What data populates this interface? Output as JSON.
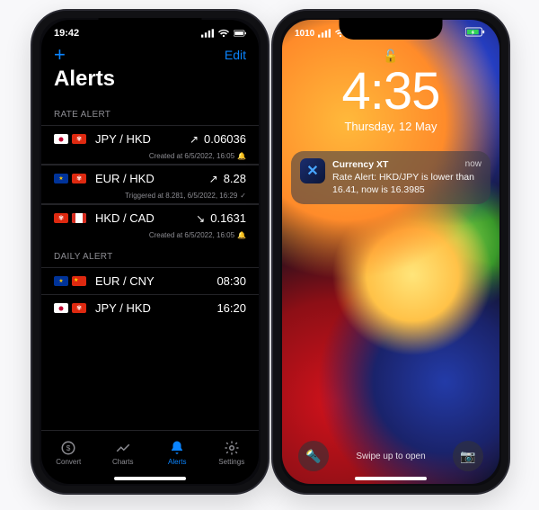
{
  "left": {
    "status": {
      "time": "19:42",
      "icons": [
        "signal",
        "wifi",
        "battery"
      ]
    },
    "nav": {
      "add": "+",
      "edit": "Edit"
    },
    "title": "Alerts",
    "sections": {
      "rate": {
        "label": "RATE ALERT",
        "rows": [
          {
            "flags": [
              "jp",
              "hk"
            ],
            "pair": "JPY / HKD",
            "dir": "↗",
            "rate": "0.06036",
            "meta": "Created at 6/5/2022, 16:05",
            "bell": "🔔"
          },
          {
            "flags": [
              "eu",
              "hk"
            ],
            "pair": "EUR / HKD",
            "dir": "↗",
            "rate": "8.28",
            "meta": "Triggered at 8.281, 6/5/2022, 16:29",
            "bell": "✓"
          },
          {
            "flags": [
              "hk",
              "ca"
            ],
            "pair": "HKD / CAD",
            "dir": "↘",
            "rate": "0.1631",
            "meta": "Created at 6/5/2022, 16:05",
            "bell": "🔔"
          }
        ]
      },
      "daily": {
        "label": "DAILY ALERT",
        "rows": [
          {
            "flags": [
              "eu",
              "cn"
            ],
            "pair": "EUR / CNY",
            "time": "08:30"
          },
          {
            "flags": [
              "jp",
              "hk"
            ],
            "pair": "JPY / HKD",
            "time": "16:20"
          }
        ]
      }
    },
    "tabs": [
      {
        "name": "Convert",
        "active": false
      },
      {
        "name": "Charts",
        "active": false
      },
      {
        "name": "Alerts",
        "active": true
      },
      {
        "name": "Settings",
        "active": false
      }
    ]
  },
  "right": {
    "status": {
      "carrier": "1010",
      "icons": [
        "signal",
        "wifi",
        "battery-charging"
      ]
    },
    "lock_icon": "🔓",
    "time": "4:35",
    "date": "Thursday, 12 May",
    "notification": {
      "app": "Currency XT",
      "when": "now",
      "body": "Rate Alert: HKD/JPY is lower than 16.41, now is 16.3985",
      "icon_glyph": "✕"
    },
    "swipe_label": "Swipe up to open",
    "torch_icon": "🔦",
    "camera_icon": "📷"
  }
}
